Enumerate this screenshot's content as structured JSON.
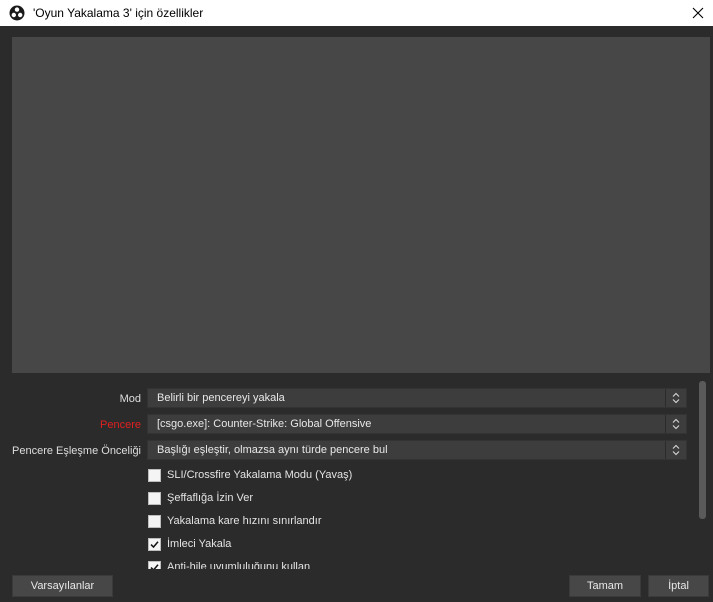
{
  "window": {
    "title": "'Oyun Yakalama 3' için özellikler",
    "icon": "obs-logo-icon"
  },
  "properties": {
    "rows": [
      {
        "label": "Mod",
        "value": "Belirli bir pencereyi yakala",
        "label_color": "#dedede"
      },
      {
        "label": "Pencere",
        "value": "[csgo.exe]: Counter-Strike: Global Offensive",
        "label_color": "#e02020"
      },
      {
        "label": "Pencere Eşleşme Önceliği",
        "value": "Başlığı eşleştir, olmazsa aynı türde pencere bul",
        "label_color": "#dedede"
      }
    ],
    "checkboxes": [
      {
        "label": "SLI/Crossfire Yakalama Modu (Yavaş)",
        "checked": false
      },
      {
        "label": "Şeffaflığa İzin Ver",
        "checked": false
      },
      {
        "label": "Yakalama kare hızını sınırlandır",
        "checked": false
      },
      {
        "label": "İmleci Yakala",
        "checked": true
      },
      {
        "label": "Anti-hile uyumluluğunu kullan",
        "checked": true
      }
    ]
  },
  "buttons": {
    "defaults": "Varsayılanlar",
    "ok": "Tamam",
    "cancel": "İptal"
  }
}
